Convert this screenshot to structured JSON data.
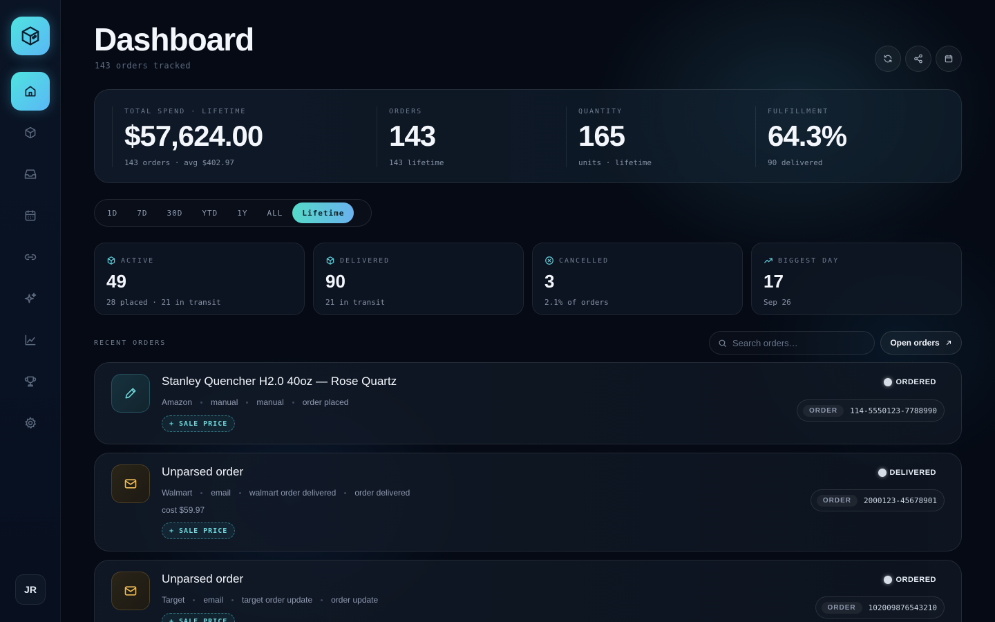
{
  "header": {
    "title": "Dashboard",
    "subtitle": "143 orders tracked"
  },
  "sidebar": {
    "items": [
      {
        "name": "home",
        "icon": "home-icon",
        "active": true
      },
      {
        "name": "packages",
        "icon": "package-icon",
        "active": false
      },
      {
        "name": "inbox",
        "icon": "inbox-icon",
        "active": false
      },
      {
        "name": "calendar",
        "icon": "calendar-icon",
        "active": false
      },
      {
        "name": "links",
        "icon": "link-icon",
        "active": false
      },
      {
        "name": "sparkles",
        "icon": "sparkles-icon",
        "active": false
      },
      {
        "name": "analytics",
        "icon": "chart-icon",
        "active": false
      },
      {
        "name": "trophy",
        "icon": "trophy-icon",
        "active": false
      },
      {
        "name": "settings",
        "icon": "gear-icon",
        "active": false
      }
    ],
    "avatar": "JR"
  },
  "stats": [
    {
      "label": "TOTAL SPEND · LIFETIME",
      "value": "$57,624.00",
      "sub": "143 orders · avg $402.97"
    },
    {
      "label": "ORDERS",
      "value": "143",
      "sub": "143 lifetime"
    },
    {
      "label": "QUANTITY",
      "value": "165",
      "sub": "units · lifetime"
    },
    {
      "label": "FULFILLMENT",
      "value": "64.3%",
      "sub": "90 delivered"
    }
  ],
  "range_tabs": [
    "1D",
    "7D",
    "30D",
    "YTD",
    "1Y",
    "ALL",
    "Lifetime"
  ],
  "active_range": "Lifetime",
  "status_cards": [
    {
      "label": "ACTIVE",
      "value": "49",
      "sub": "28 placed · 21 in transit",
      "icon": "package-icon"
    },
    {
      "label": "DELIVERED",
      "value": "90",
      "sub": "21 in transit",
      "icon": "package-icon"
    },
    {
      "label": "CANCELLED",
      "value": "3",
      "sub": "2.1% of orders",
      "icon": "x-circle-icon"
    },
    {
      "label": "BIGGEST DAY",
      "value": "17",
      "sub": "Sep 26",
      "icon": "trending-up-icon"
    }
  ],
  "recent": {
    "label": "RECENT ORDERS",
    "search_placeholder": "Search orders…",
    "open_label": "Open orders"
  },
  "orders": [
    {
      "title": "Stanley Quencher H2.0 40oz — Rose Quartz",
      "meta": [
        "Amazon",
        "manual",
        "manual",
        "order placed"
      ],
      "cost": "",
      "chip": "+ SALE PRICE",
      "status": "ORDERED",
      "order_tag": "ORDER",
      "order_id": "114-5550123-7788990",
      "icon": "pencil-icon"
    },
    {
      "title": "Unparsed order",
      "meta": [
        "Walmart",
        "email",
        "walmart order delivered",
        "order delivered"
      ],
      "cost": "cost $59.97",
      "chip": "+ SALE PRICE",
      "status": "DELIVERED",
      "order_tag": "ORDER",
      "order_id": "2000123-45678901",
      "icon": "mail-icon"
    },
    {
      "title": "Unparsed order",
      "meta": [
        "Target",
        "email",
        "target order update",
        "order update"
      ],
      "cost": "",
      "chip": "+ SALE PRICE",
      "status": "ORDERED",
      "order_tag": "ORDER",
      "order_id": "102009876543210",
      "icon": "mail-icon"
    }
  ],
  "colors": {
    "accent_start": "#4fe3e0",
    "accent_end": "#5ab8f5",
    "background": "#050a14",
    "mail_icon": "#f0bd5a",
    "chip_text": "#6fd8dc"
  }
}
